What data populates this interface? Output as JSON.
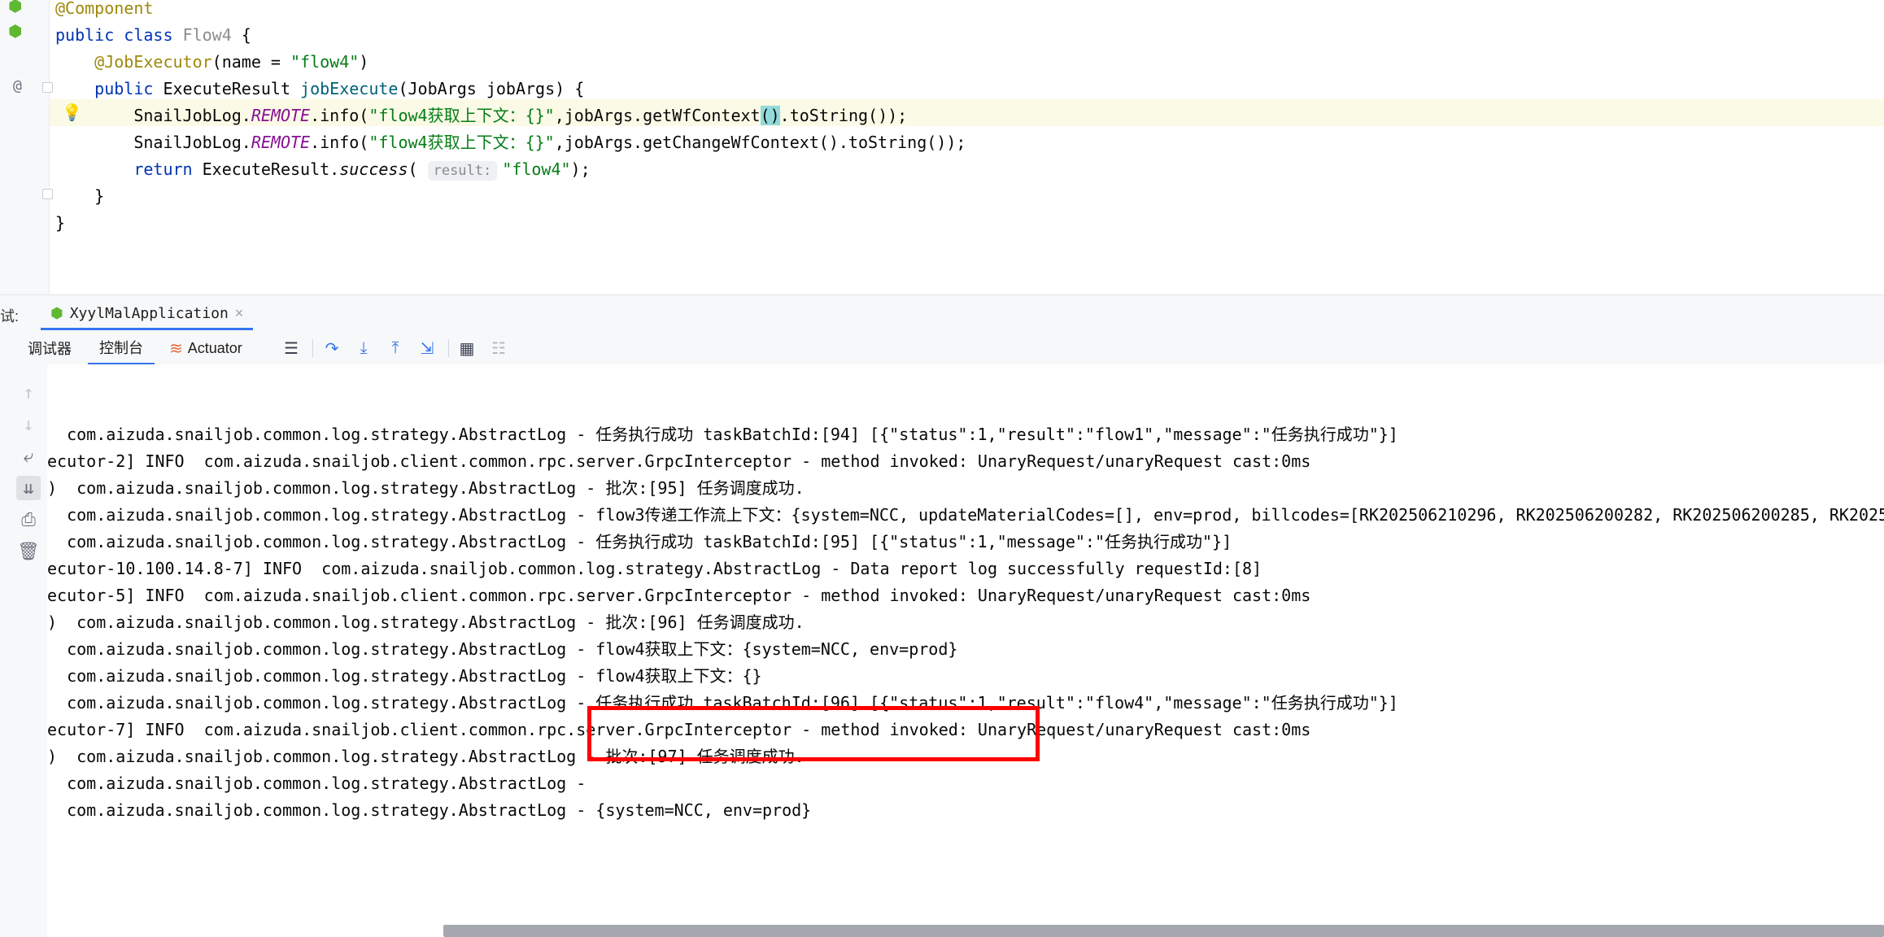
{
  "editor": {
    "lines": [
      [
        {
          "t": "@Component",
          "c": "an"
        }
      ],
      [
        {
          "t": "public ",
          "c": "kw"
        },
        {
          "t": "class ",
          "c": "kw"
        },
        {
          "t": "Flow4",
          "c": "gr"
        },
        {
          "t": " {"
        }
      ],
      [
        {
          "t": "    "
        },
        {
          "t": "@JobExecutor",
          "c": "an"
        },
        {
          "t": "(name = "
        },
        {
          "t": "\"flow4\"",
          "c": "st"
        },
        {
          "t": ")"
        }
      ],
      [
        {
          "t": "    "
        },
        {
          "t": "public ",
          "c": "kw"
        },
        {
          "t": "ExecuteResult "
        },
        {
          "t": "jobExecute",
          "c": "fn"
        },
        {
          "t": "(JobArgs jobArgs) {"
        }
      ],
      [
        {
          "t": "        SnailJobLog."
        },
        {
          "t": "REMOTE",
          "c": "cn"
        },
        {
          "t": ".info("
        },
        {
          "t": "\"flow4获取上下文：{}\"",
          "c": "st"
        },
        {
          "t": ",jobArgs.getWfContext"
        },
        {
          "t": "()",
          "c": "brk"
        },
        {
          "t": ".toString());"
        }
      ],
      [
        {
          "t": "        SnailJobLog."
        },
        {
          "t": "REMOTE",
          "c": "cn"
        },
        {
          "t": ".info("
        },
        {
          "t": "\"flow4获取上下文：{}\"",
          "c": "st"
        },
        {
          "t": ",jobArgs.getChangeWfContext().toString());"
        }
      ],
      [
        {
          "t": "        "
        },
        {
          "t": "return ",
          "c": "kw"
        },
        {
          "t": "ExecuteResult."
        },
        {
          "t": "success",
          "c": "it"
        },
        {
          "t": "( "
        },
        {
          "t": "result:",
          "c": "hint"
        },
        {
          "t": "\"flow4\"",
          "c": "st"
        },
        {
          "t": ");"
        }
      ],
      [
        {
          "t": "    }"
        }
      ],
      [
        {
          "t": "}"
        }
      ]
    ]
  },
  "toolwindow": {
    "run_label": "试:",
    "run_tab_label": "XyylMalApplication",
    "close_glyph": "×",
    "tabs": {
      "debugger": "调试器",
      "console": "控制台",
      "actuator": "Actuator"
    }
  },
  "console": {
    "lines": [
      "  com.aizuda.snailjob.common.log.strategy.AbstractLog - 任务执行成功 taskBatchId:[94] [{\"status\":1,\"result\":\"flow1\",\"message\":\"任务执行成功\"}]",
      "ecutor-2] INFO  com.aizuda.snailjob.client.common.rpc.server.GrpcInterceptor - method invoked: UnaryRequest/unaryRequest cast:0ms",
      ")  com.aizuda.snailjob.common.log.strategy.AbstractLog - 批次:[95] 任务调度成功.",
      "  com.aizuda.snailjob.common.log.strategy.AbstractLog - flow3传递工作流上下文：{system=NCC, updateMaterialCodes=[], env=prod, billcodes=[RK202506210296, RK202506200282, RK202506200285, RK2025",
      "  com.aizuda.snailjob.common.log.strategy.AbstractLog - 任务执行成功 taskBatchId:[95] [{\"status\":1,\"message\":\"任务执行成功\"}]",
      "ecutor-10.100.14.8-7] INFO  com.aizuda.snailjob.common.log.strategy.AbstractLog - Data report log successfully requestId:[8]",
      "ecutor-5] INFO  com.aizuda.snailjob.client.common.rpc.server.GrpcInterceptor - method invoked: UnaryRequest/unaryRequest cast:0ms",
      ")  com.aizuda.snailjob.common.log.strategy.AbstractLog - 批次:[96] 任务调度成功.",
      "  com.aizuda.snailjob.common.log.strategy.AbstractLog - flow4获取上下文：{system=NCC, env=prod}",
      "  com.aizuda.snailjob.common.log.strategy.AbstractLog - flow4获取上下文：{}",
      "  com.aizuda.snailjob.common.log.strategy.AbstractLog - 任务执行成功 taskBatchId:[96] [{\"status\":1,\"result\":\"flow4\",\"message\":\"任务执行成功\"}]",
      "ecutor-7] INFO  com.aizuda.snailjob.client.common.rpc.server.GrpcInterceptor - method invoked: UnaryRequest/unaryRequest cast:0ms",
      ")  com.aizuda.snailjob.common.log.strategy.AbstractLog - 批次:[97] 任务调度成功.",
      "  com.aizuda.snailjob.common.log.strategy.AbstractLog - ",
      "  com.aizuda.snailjob.common.log.strategy.AbstractLog - {system=NCC, env=prod}"
    ]
  },
  "colors": {
    "accent": "#3574f0",
    "highlight_box": "#ff0000"
  }
}
